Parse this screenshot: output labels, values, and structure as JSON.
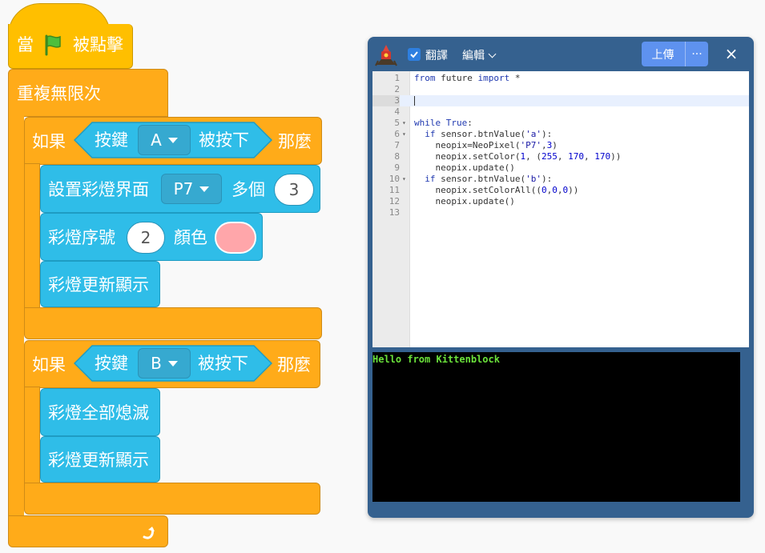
{
  "blocks": {
    "hat": {
      "prefix": "當",
      "suffix": "被點擊"
    },
    "forever": {
      "label": "重複無限次"
    },
    "if1": {
      "if_label": "如果",
      "then_label": "那麼",
      "condition": {
        "prefix": "按鍵",
        "key": "A",
        "suffix": "被按下"
      },
      "children": {
        "setup": {
          "prefix": "設置彩燈界面",
          "pin": "P7",
          "mid": "多個",
          "count": "3"
        },
        "setcolor": {
          "prefix": "彩燈序號",
          "index": "2",
          "mid": "顏色",
          "color": "#ffa6aa"
        },
        "update": {
          "label": "彩燈更新顯示"
        }
      }
    },
    "if2": {
      "if_label": "如果",
      "then_label": "那麼",
      "condition": {
        "prefix": "按鍵",
        "key": "B",
        "suffix": "被按下"
      },
      "children": {
        "off": {
          "label": "彩燈全部熄滅"
        },
        "update": {
          "label": "彩燈更新顯示"
        }
      }
    }
  },
  "code_window": {
    "translate_label": "翻譯",
    "translate_checked": true,
    "edit_label": "編輯",
    "upload_label": "上傳",
    "more_label": "···",
    "close_label": "×",
    "active_line": 3,
    "lines": [
      {
        "n": "1",
        "fold": "",
        "code": "from future import *"
      },
      {
        "n": "2",
        "fold": "",
        "code": ""
      },
      {
        "n": "3",
        "fold": "",
        "code": ""
      },
      {
        "n": "4",
        "fold": "",
        "code": ""
      },
      {
        "n": "5",
        "fold": "▾",
        "code": "while True:"
      },
      {
        "n": "6",
        "fold": "▾",
        "code": "  if sensor.btnValue('a'):"
      },
      {
        "n": "7",
        "fold": "",
        "code": "    neopix=NeoPixel('P7',3)"
      },
      {
        "n": "8",
        "fold": "",
        "code": "    neopix.setColor(1, (255, 170, 170))"
      },
      {
        "n": "9",
        "fold": "",
        "code": "    neopix.update()"
      },
      {
        "n": "10",
        "fold": "▾",
        "code": "  if sensor.btnValue('b'):"
      },
      {
        "n": "11",
        "fold": "",
        "code": "    neopix.setColorAll((0,0,0))"
      },
      {
        "n": "12",
        "fold": "",
        "code": "    neopix.update()"
      },
      {
        "n": "13",
        "fold": "",
        "code": ""
      }
    ],
    "console_output": "Hello from Kittenblock"
  },
  "colors": {
    "control": "#ffab19",
    "event": "#ffbf00",
    "sensing": "#2fbde8",
    "window_frame": "#35618f",
    "console_text": "#6be33b"
  }
}
